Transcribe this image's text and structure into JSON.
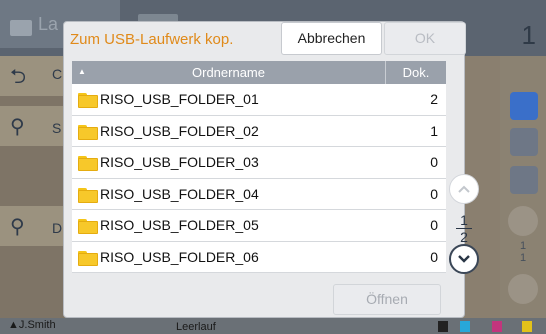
{
  "background": {
    "tab_label": "La",
    "page_number": "1",
    "left_letters": [
      "C",
      "S",
      "D"
    ],
    "right_fraction": {
      "current": "1",
      "total": "1"
    },
    "bottom_user": "J.Smith",
    "bottom_status": "Leerlauf",
    "ink_labels": [
      "K",
      "C",
      "M",
      "Y"
    ]
  },
  "dialog": {
    "title": "Zum USB-Laufwerk kop.",
    "cancel_label": "Abbrechen",
    "ok_label": "OK",
    "open_label": "Öffnen",
    "table": {
      "sort_indicator": "▲",
      "col_name": "Ordnername",
      "col_count": "Dok.",
      "rows": [
        {
          "name": "RISO_USB_FOLDER_01",
          "count": "2"
        },
        {
          "name": "RISO_USB_FOLDER_02",
          "count": "1"
        },
        {
          "name": "RISO_USB_FOLDER_03",
          "count": "0"
        },
        {
          "name": "RISO_USB_FOLDER_04",
          "count": "0"
        },
        {
          "name": "RISO_USB_FOLDER_05",
          "count": "0"
        },
        {
          "name": "RISO_USB_FOLDER_06",
          "count": "0"
        }
      ]
    },
    "pager": {
      "current": "1",
      "total": "2"
    }
  },
  "colors": {
    "title_accent": "#e08a1a",
    "folder_yellow": "#f7c82a",
    "active_blue": "#3a6fc9"
  }
}
